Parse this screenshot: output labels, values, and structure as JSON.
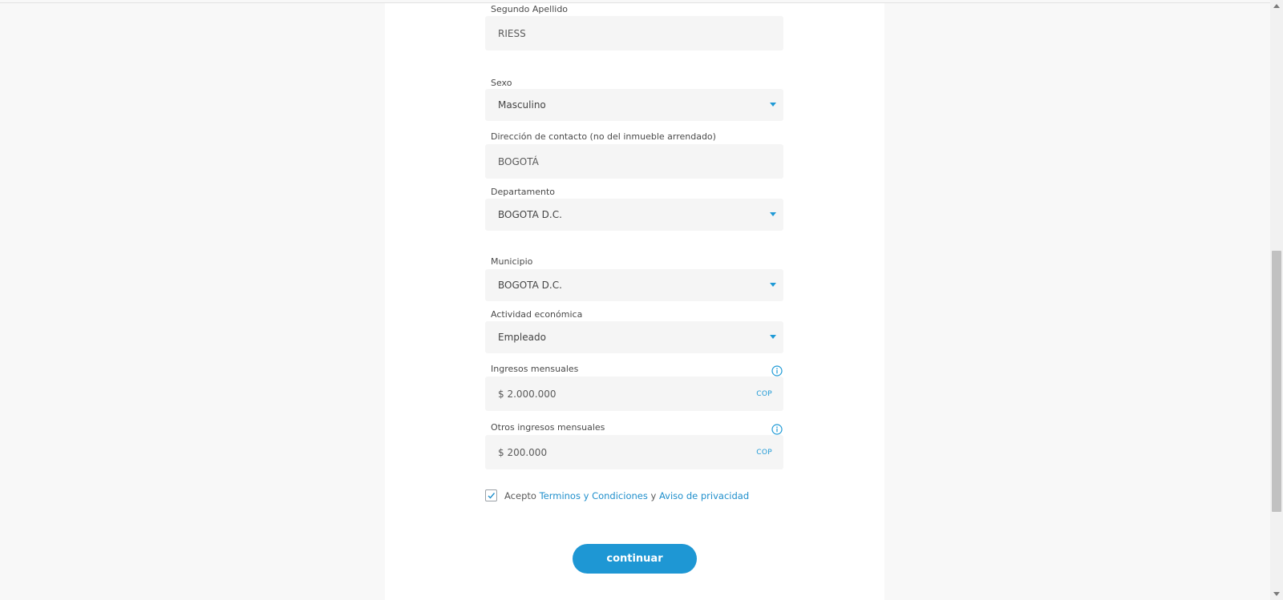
{
  "form": {
    "segundo_apellido": {
      "label": "Segundo Apellido",
      "value": "RIESS"
    },
    "sexo": {
      "label": "Sexo",
      "value": "Masculino"
    },
    "direccion": {
      "label": "Dirección de contacto (no del inmueble arrendado)",
      "value": "BOGOTÁ"
    },
    "departamento": {
      "label": "Departamento",
      "value": "BOGOTA D.C."
    },
    "municipio": {
      "label": "Municipio",
      "value": "BOGOTA D.C."
    },
    "actividad": {
      "label": "Actividad económica",
      "value": "Empleado"
    },
    "ingresos": {
      "label": "Ingresos mensuales",
      "value": "$ 2.000.000",
      "currency": "COP"
    },
    "otros_ingresos": {
      "label": "Otros ingresos mensuales",
      "value": "$ 200.000",
      "currency": "COP"
    }
  },
  "terms": {
    "checked": true,
    "prefix": "Acepto",
    "link_terms": "Terminos y Condiciones",
    "conjunction": "y",
    "link_privacy": "Aviso de privacidad"
  },
  "submit": {
    "label": "continuar"
  },
  "colors": {
    "accent": "#1e97d4",
    "field_bg": "#f5f5f5",
    "page_bg": "#f8f8f8"
  },
  "icons": {
    "dropdown": "caret-down-icon",
    "info": "info-icon",
    "check": "check-icon"
  }
}
